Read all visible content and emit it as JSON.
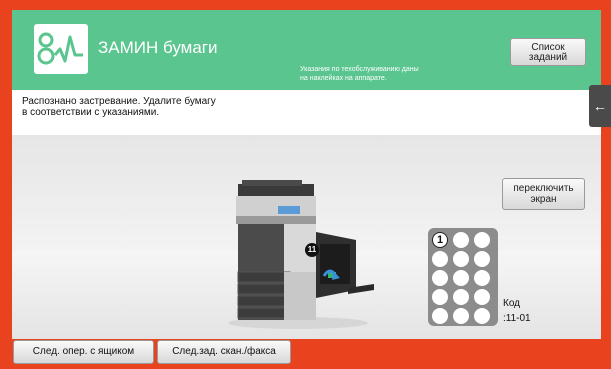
{
  "header": {
    "title": "ЗАМИН бумаги",
    "maintenance_note_line1": "Указания по техобслуживанию даны",
    "maintenance_note_line2": "на наклейках на аппарате.",
    "list_button_line1": "Список",
    "list_button_line2": "заданий"
  },
  "message": {
    "line1": "Распознано застревание. Удалите бумагу",
    "line2": "в соответствии с указаниями."
  },
  "side_tab": {
    "icon": "arrow-left-icon",
    "glyph": "←"
  },
  "switch_button": {
    "line1": "переключить",
    "line2": "экран"
  },
  "machine": {
    "callout": "11",
    "icon": "mfp-printer-icon"
  },
  "code_panel": {
    "active_number": "1",
    "label_line1": "Код",
    "label_line2": ":11-01"
  },
  "bottom_bar": {
    "button1": "След. опер. с ящиком",
    "button2": "След.зад. скан./факса"
  },
  "colors": {
    "header_green": "#5ac58e",
    "frame_red": "#e8431e",
    "code_panel_gray": "#8c8c8c"
  }
}
